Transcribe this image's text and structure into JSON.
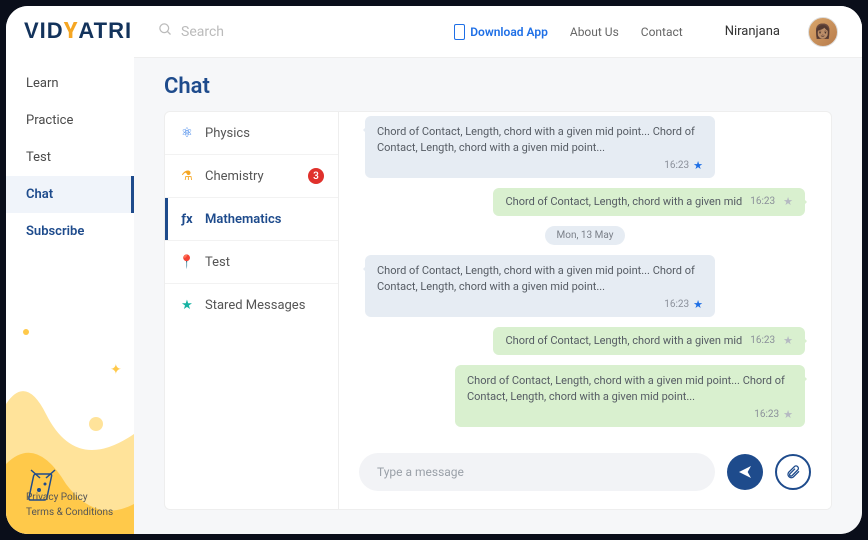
{
  "brand": "VIDYATRI",
  "search": {
    "placeholder": "Search"
  },
  "header": {
    "download": "Download App",
    "about": "About Us",
    "contact": "Contact",
    "user": "Niranjana"
  },
  "sidebar": {
    "items": [
      {
        "label": "Learn"
      },
      {
        "label": "Practice"
      },
      {
        "label": "Test"
      },
      {
        "label": "Chat"
      },
      {
        "label": "Subscribe"
      }
    ],
    "footer": {
      "privacy": "Privacy Policy",
      "terms": "Terms & Conditions"
    }
  },
  "page": {
    "title": "Chat"
  },
  "subjects": [
    {
      "id": "physics",
      "label": "Physics",
      "badge": null
    },
    {
      "id": "chemistry",
      "label": "Chemistry",
      "badge": "3"
    },
    {
      "id": "mathematics",
      "label": "Mathematics",
      "badge": null
    },
    {
      "id": "test",
      "label": "Test",
      "badge": null
    },
    {
      "id": "starred",
      "label": "Stared Messages",
      "badge": null
    }
  ],
  "messages": [
    {
      "dir": "in",
      "text": "Chord of Contact, Length, chord with a given mid point... Chord of Contact, Length, chord with a given mid point...",
      "time": "16:23",
      "star": "blue"
    },
    {
      "dir": "out",
      "text": "Chord of Contact, Length, chord with a given mid",
      "time": "16:23",
      "star": "grey",
      "slim": true
    },
    {
      "dir": "date",
      "text": "Mon, 13 May"
    },
    {
      "dir": "in",
      "text": "Chord of Contact, Length, chord with a given mid point... Chord of Contact, Length, chord with a given mid point...",
      "time": "16:23",
      "star": "blue"
    },
    {
      "dir": "out",
      "text": "Chord of Contact, Length, chord with a given mid",
      "time": "16:23",
      "star": "grey",
      "slim": true
    },
    {
      "dir": "out",
      "text": "Chord of Contact, Length, chord with a given mid point... Chord of Contact, Length, chord with a given mid point...",
      "time": "16:23",
      "star": "grey"
    }
  ],
  "composer": {
    "placeholder": "Type a message"
  }
}
